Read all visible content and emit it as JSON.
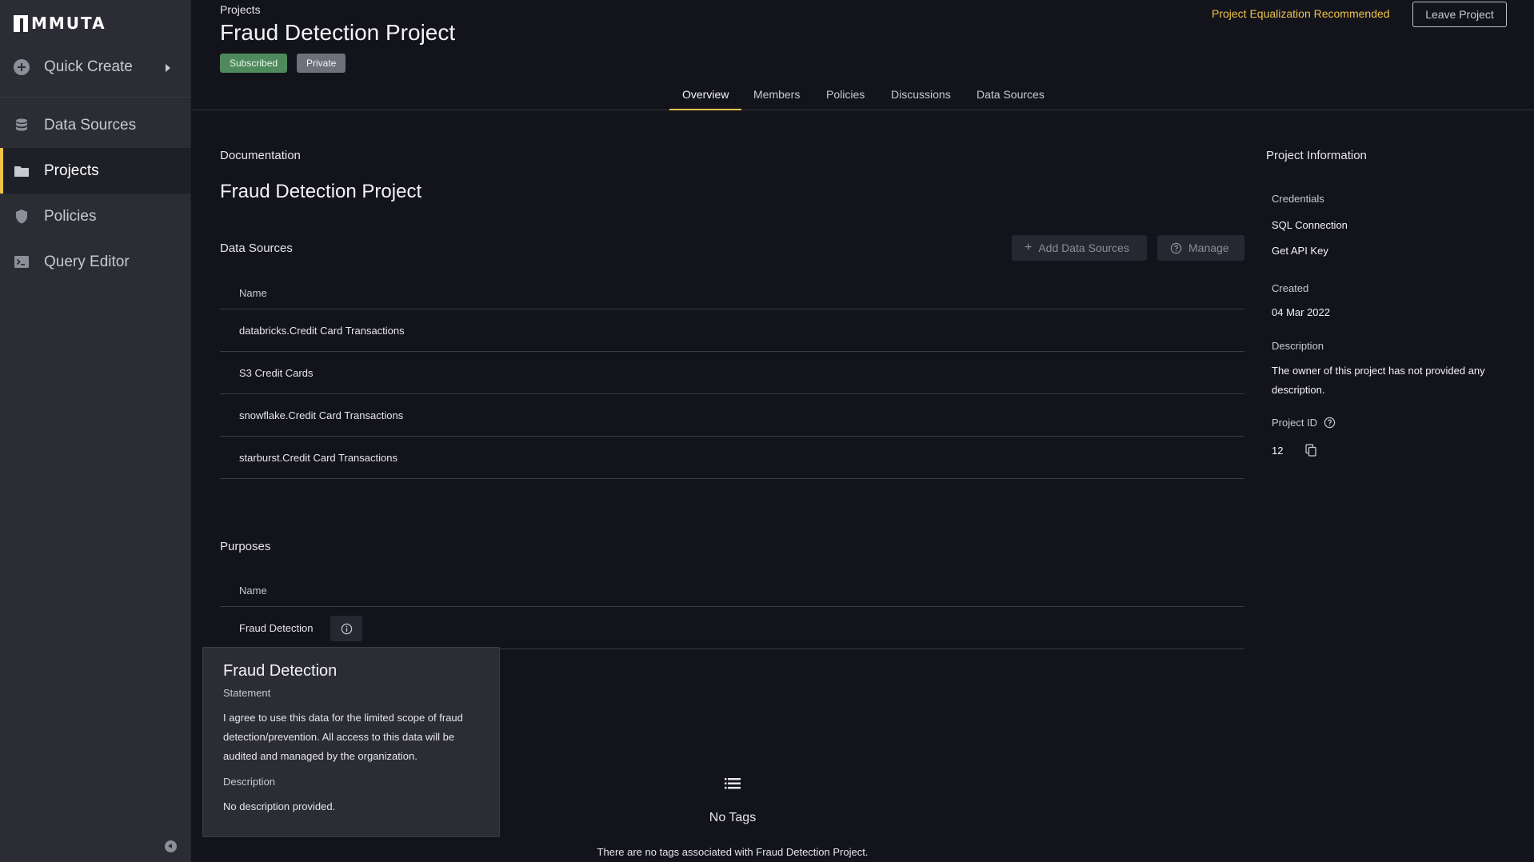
{
  "colors": {
    "accent": "#f0c24b",
    "subscribed": "#4e8a5b",
    "private": "#6f7079"
  },
  "sidebar": {
    "logo": "MMUTA",
    "quick_create": "Quick Create",
    "items": [
      {
        "label": "Data Sources",
        "icon": "database-icon"
      },
      {
        "label": "Projects",
        "icon": "folder-icon",
        "active": true
      },
      {
        "label": "Policies",
        "icon": "shield-icon"
      },
      {
        "label": "Query Editor",
        "icon": "terminal-icon"
      }
    ]
  },
  "header": {
    "breadcrumb": "Projects",
    "title": "Fraud Detection Project",
    "badges": [
      "Subscribed",
      "Private"
    ],
    "notice": "Project Equalization Recommended",
    "leave_button": "Leave Project"
  },
  "tabs": [
    "Overview",
    "Members",
    "Policies",
    "Discussions",
    "Data Sources"
  ],
  "documentation": {
    "label": "Documentation",
    "title": "Fraud Detection Project"
  },
  "data_sources": {
    "label": "Data Sources",
    "add_button": "Add Data Sources",
    "manage_button": "Manage",
    "column": "Name",
    "rows": [
      "databricks.Credit Card Transactions",
      "S3 Credit Cards",
      "snowflake.Credit Card Transactions",
      "starburst.Credit Card Transactions"
    ]
  },
  "purposes": {
    "label": "Purposes",
    "column": "Name",
    "rows": [
      "Fraud Detection"
    ]
  },
  "tooltip": {
    "title": "Fraud Detection",
    "statement_label": "Statement",
    "statement": "I agree to use this data for the limited scope of fraud detection/prevention. All access to this data will be audited and managed by the organization.",
    "description_label": "Description",
    "description": "No description provided."
  },
  "tags": {
    "title": "No Tags",
    "text": "There are no tags associated with Fraud Detection Project."
  },
  "project_info": {
    "title": "Project Information",
    "credentials_label": "Credentials",
    "sql_connection": "SQL Connection",
    "api_key": "Get API Key",
    "created_label": "Created",
    "created": "04 Mar 2022",
    "description_label": "Description",
    "description": "The owner of this project has not provided any description.",
    "project_id_label": "Project ID",
    "project_id": "12"
  }
}
